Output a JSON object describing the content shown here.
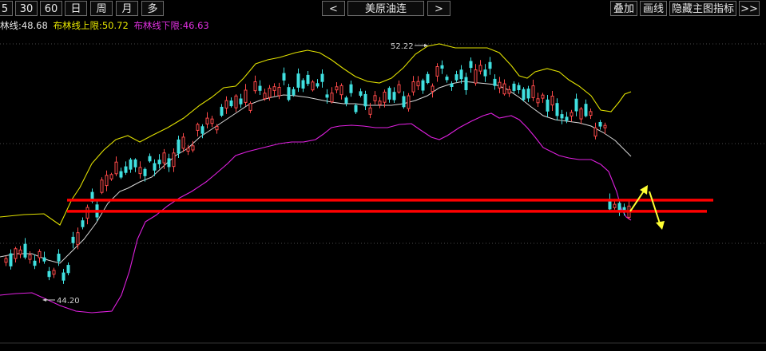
{
  "toolbar": {
    "period_buttons": [
      "5",
      "30",
      "60",
      "日",
      "周",
      "月",
      "多"
    ],
    "prev_symbol": "<",
    "symbol_name": "美原油连",
    "next_symbol": ">",
    "overlay_button": "叠加",
    "draw_line_button": "画线",
    "hide_indicator_button": "隐藏主图指标",
    "expand_button": ">>"
  },
  "indicator": {
    "mid_label": "林线:",
    "mid_value": "48.68",
    "upper_label": "布林线上限:",
    "upper_value": "50.72",
    "lower_label": "布林线下限:",
    "lower_value": "46.63"
  },
  "colors": {
    "background": "#000000",
    "up": "#ff4a4a",
    "down": "#40e0e0",
    "mid_band": "#d8d8d8",
    "upper_band": "#e0e000",
    "lower_band": "#e020e0",
    "support_line": "#ff0000",
    "arrow": "#ffff33",
    "grid": "#4a4a4a"
  },
  "chart_data": {
    "type": "candlestick",
    "title": "美原油连",
    "annotations": {
      "high_label": "52.22",
      "low_label": "44.20"
    },
    "price_range": [
      43.2,
      53.6
    ],
    "support_levels": [
      47.7,
      47.3
    ],
    "bollinger": {
      "mid_value": 48.68,
      "upper_value": 50.72,
      "lower_value": 46.63
    },
    "candles_count": 131
  }
}
